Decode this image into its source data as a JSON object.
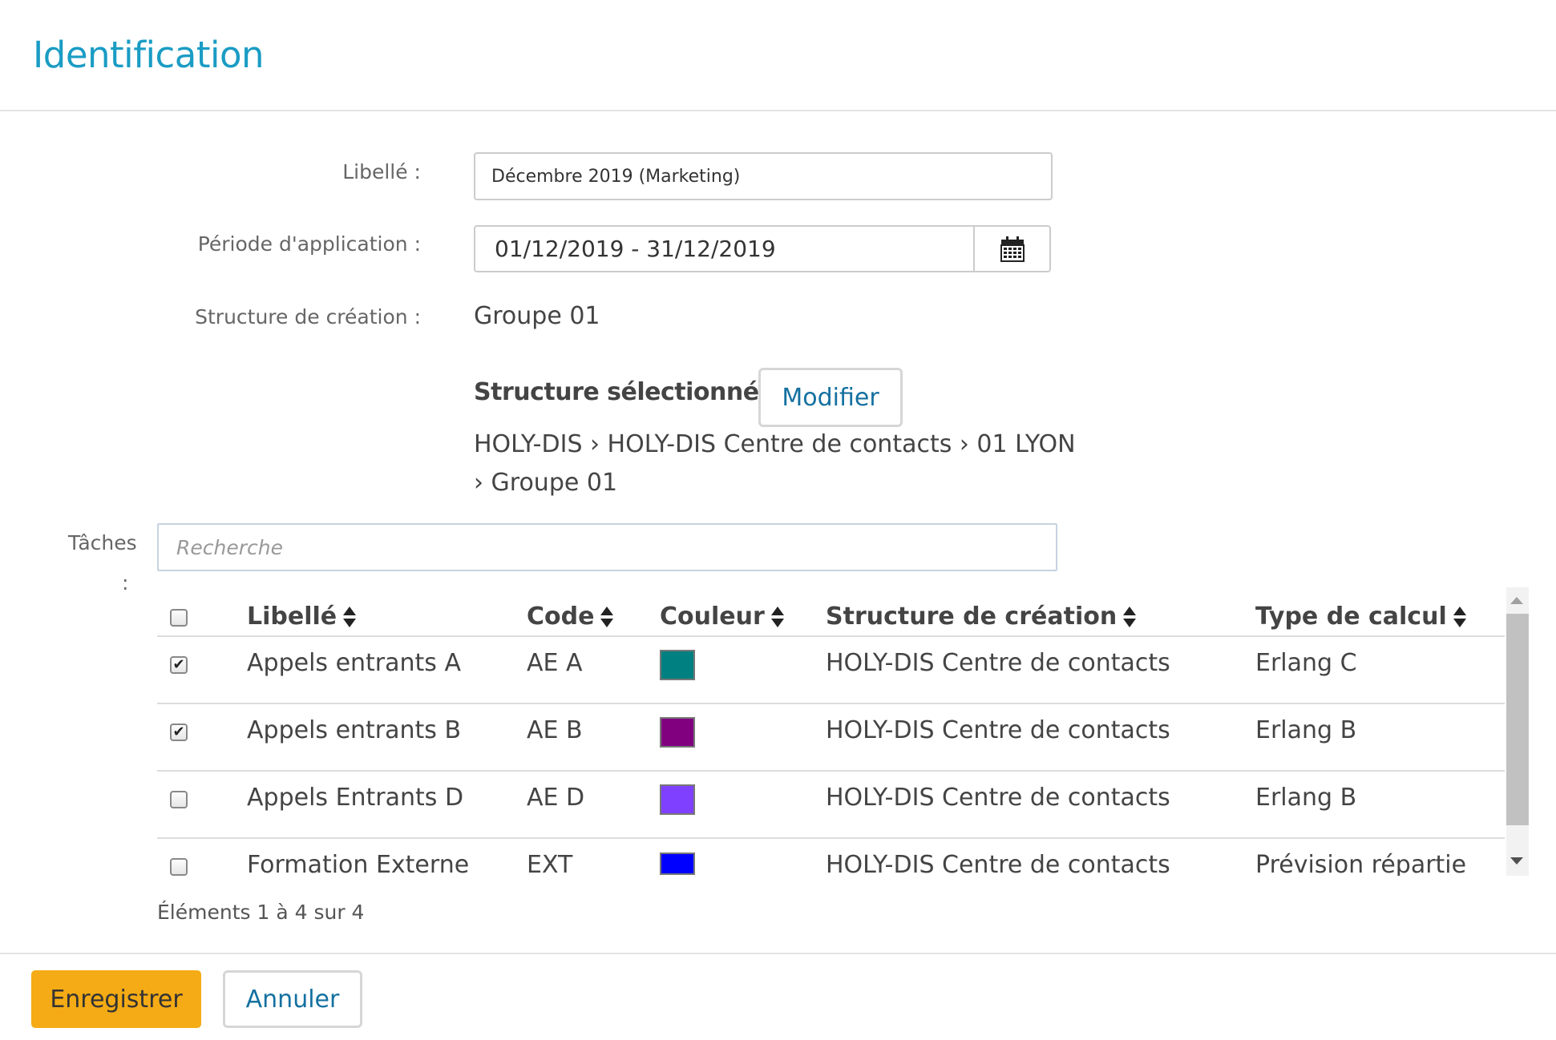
{
  "header": {
    "title": "Identification"
  },
  "form": {
    "libelle_label": "Libellé :",
    "libelle_value": "Décembre 2019 (Marketing)",
    "periode_label": "Période d'application  :",
    "periode_value": "01/12/2019 - 31/12/2019",
    "structure_creation_label": "Structure de création :",
    "structure_creation_value": "Groupe 01",
    "structure_selectionnee": "Structure sélectionnée (1)",
    "modifier_label": "Modifier",
    "path_line1": "HOLY-DIS › HOLY-DIS Centre de contacts › 01 LYON",
    "path_line2": "› Groupe 01",
    "taches_label": "Tâches",
    "taches_colon": ":",
    "search_placeholder": "Recherche"
  },
  "table": {
    "columns": [
      "Libellé",
      "Code",
      "Couleur",
      "Structure de création",
      "Type de calcul"
    ],
    "rows": [
      {
        "checked": true,
        "libelle": "Appels entrants A",
        "code": "AE A",
        "color": "#008080",
        "structure": "HOLY-DIS Centre de contacts",
        "type": "Erlang C"
      },
      {
        "checked": true,
        "libelle": "Appels entrants B",
        "code": "AE B",
        "color": "#800080",
        "structure": "HOLY-DIS Centre de contacts",
        "type": "Erlang B"
      },
      {
        "checked": false,
        "libelle": "Appels Entrants D",
        "code": "AE D",
        "color": "#8040ff",
        "structure": "HOLY-DIS Centre de contacts",
        "type": "Erlang B"
      },
      {
        "checked": false,
        "libelle": "Formation Externe",
        "code": "EXT",
        "color": "#0000ff",
        "structure": "HOLY-DIS Centre de contacts",
        "type": "Prévision répartie"
      }
    ],
    "footer": "Éléments 1 à 4 sur 4"
  },
  "actions": {
    "save_label": "Enregistrer",
    "cancel_label": "Annuler"
  },
  "colors": {
    "title": "#1a9cc4",
    "primary_button": "#f5ab15",
    "link": "#1470a0"
  }
}
